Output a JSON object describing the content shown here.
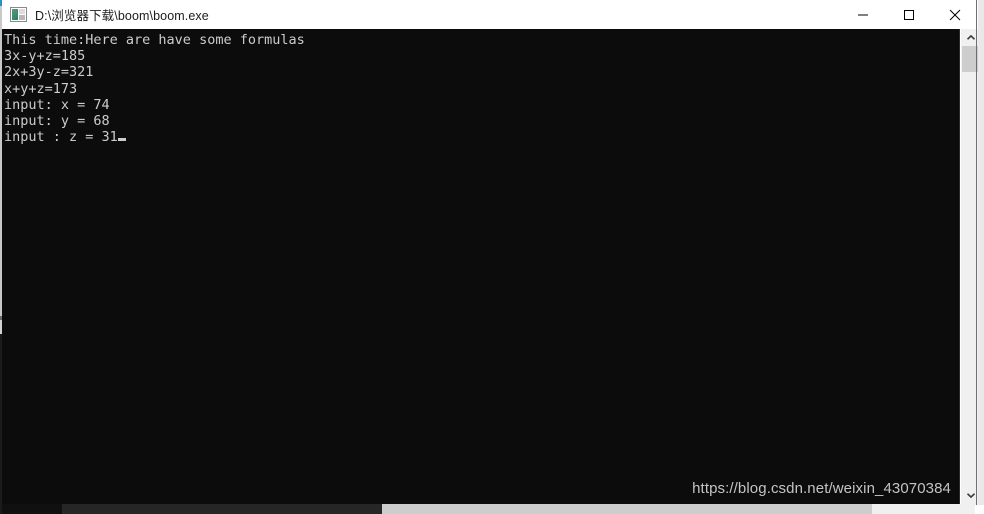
{
  "window": {
    "title": "D:\\浏览器下载\\boom\\boom.exe",
    "icon": "console-app-icon",
    "controls": {
      "minimize_label": "Minimize",
      "maximize_label": "Maximize",
      "close_label": "Close"
    }
  },
  "console": {
    "background_color": "#0c0c0c",
    "text_color": "#cccccc",
    "lines": [
      "This time:Here are have some formulas",
      "3x-y+z=185",
      "2x+3y-z=321",
      "x+y+z=173",
      "input: x = 74",
      "input: y = 68",
      "input : z = 31"
    ],
    "cursor_visible": true
  },
  "watermark": {
    "text": "https://blog.csdn.net/weixin_43070384",
    "color": "#c4c4c4"
  },
  "scrollbars": {
    "vertical": {
      "up_arrow": "chevron-up-icon",
      "down_arrow": "chevron-down-icon",
      "thumb_color": "#cdcdcd",
      "track_color": "#f0f0f0"
    },
    "horizontal": {
      "thumb_color": "#cdcdcd",
      "track_color": "#f0f0f0"
    }
  }
}
